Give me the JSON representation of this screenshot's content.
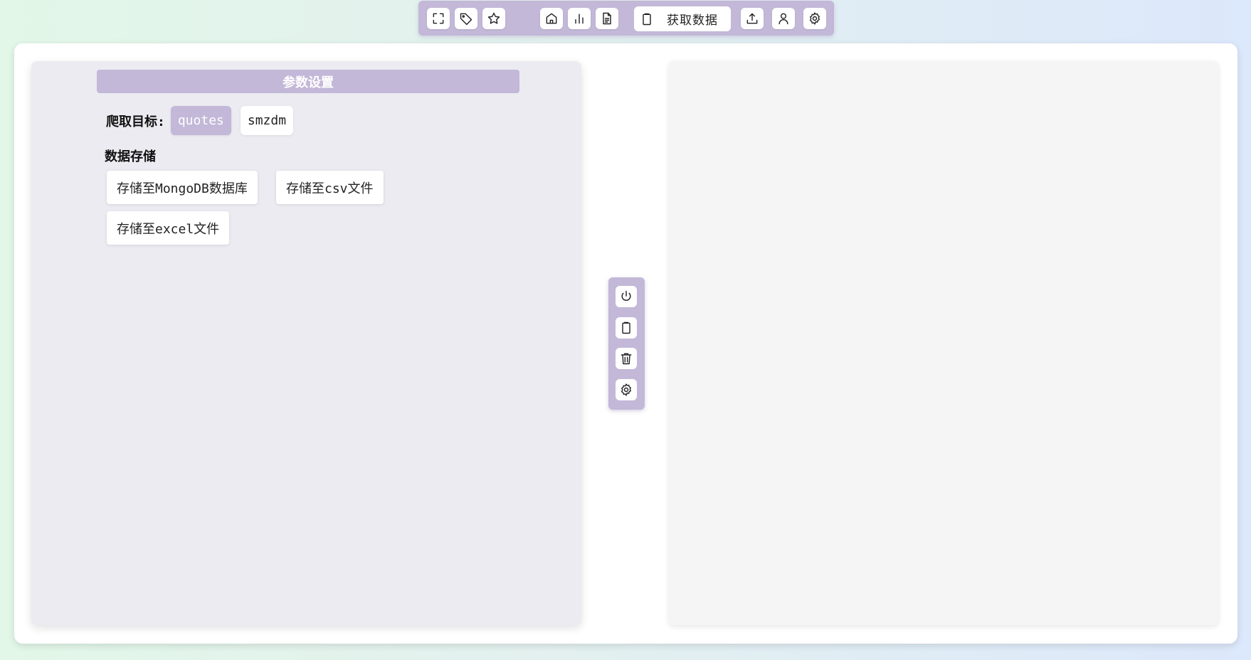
{
  "toolbar": {
    "fetch_label": "获取数据",
    "icons": [
      "fullscreen-icon",
      "tag-icon",
      "star-icon",
      "home-icon",
      "bar-chart-icon",
      "document-icon",
      "clipboard-icon",
      "upload-icon",
      "user-icon",
      "gear-icon"
    ]
  },
  "left_panel": {
    "title": "参数设置",
    "target_label": "爬取目标:",
    "targets": [
      {
        "label": "quotes",
        "selected": true
      },
      {
        "label": "smzdm",
        "selected": false
      }
    ],
    "storage_label": "数据存储",
    "storage_buttons": [
      "存储至MongoDB数据库",
      "存储至csv文件",
      "存储至excel文件"
    ]
  },
  "side_tools": {
    "icons": [
      "power-icon",
      "clipboard-icon",
      "trash-icon",
      "gear-icon"
    ]
  },
  "colors": {
    "accent": "#c3b8d8",
    "left_panel_bg": "#ebebf1",
    "right_panel_bg": "#f5f5f5"
  }
}
